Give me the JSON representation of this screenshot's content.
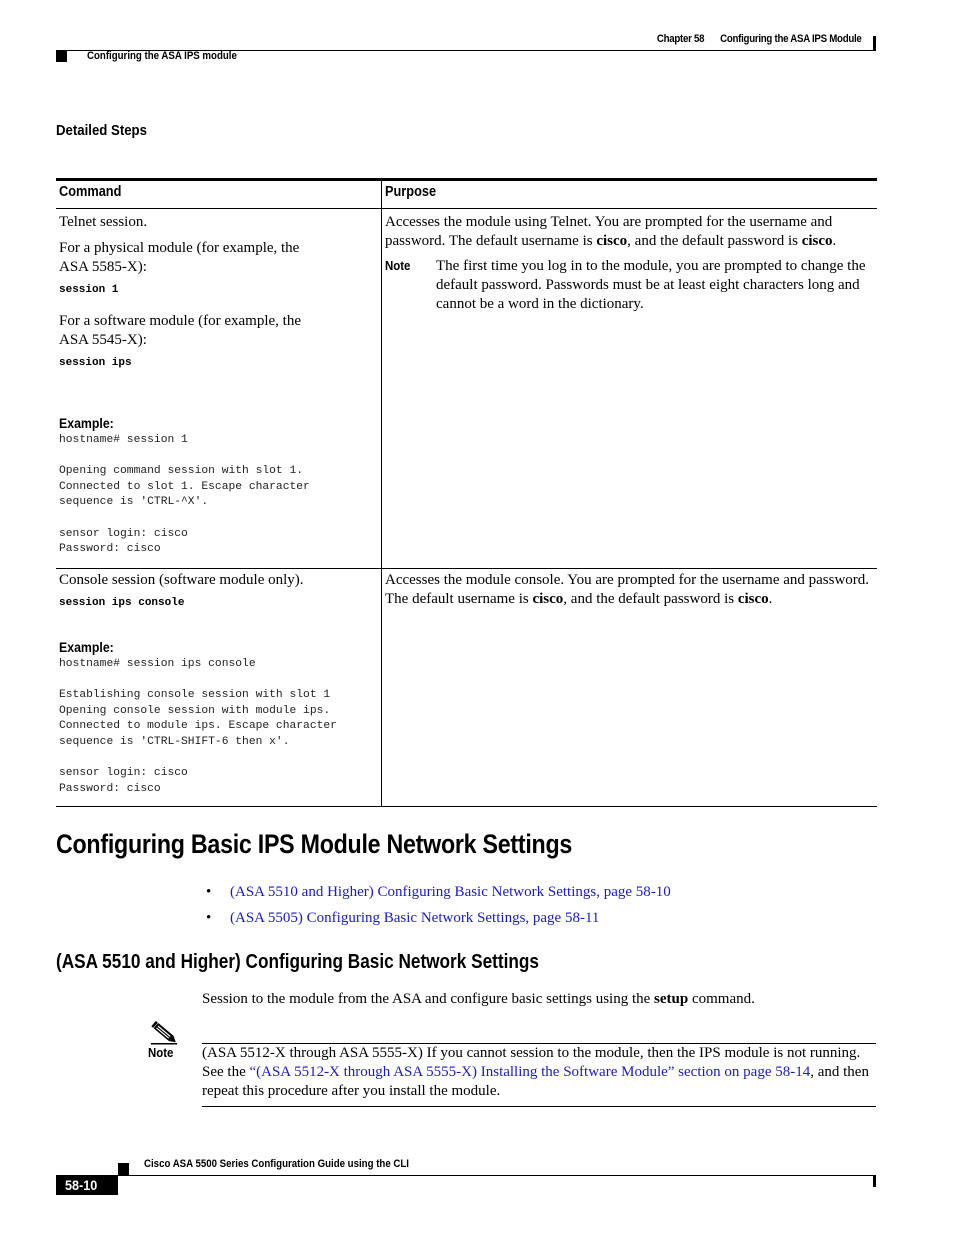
{
  "header": {
    "chapter": "Chapter 58",
    "chapter_title": "Configuring the ASA IPS Module",
    "section": "Configuring the ASA IPS module"
  },
  "detailed_steps_heading": "Detailed Steps",
  "table": {
    "columns": [
      "Command",
      "Purpose"
    ],
    "rows": [
      {
        "command": {
          "intro": "Telnet session.",
          "physical_label": "For a physical module (for example, the ASA 5585-X):",
          "physical_cmd": "session 1",
          "software_label": "For a software module (for example, the ASA 5545-X):",
          "software_cmd": "session ips",
          "example_label": "Example:",
          "example_code": "hostname# session 1\n\nOpening command session with slot 1.\nConnected to slot 1. Escape character\nsequence is 'CTRL-^X'.\n\nsensor login: cisco\nPassword: cisco"
        },
        "purpose": {
          "text_before": "Accesses the module using Telnet. You are prompted for the username and password. The default username is ",
          "bold1": "cisco",
          "text_middle": ", and the default password is ",
          "bold2": "cisco",
          "text_after": ".",
          "note_label": "Note",
          "note_text": "The first time you log in to the module, you are prompted to change the default password. Passwords must be at least eight characters long and cannot be a word in the dictionary."
        }
      },
      {
        "command": {
          "intro": "Console session (software module only).",
          "cmd": "session ips console",
          "example_label": "Example:",
          "example_code": "hostname# session ips console\n\nEstablishing console session with slot 1\nOpening console session with module ips.\nConnected to module ips. Escape character\nsequence is 'CTRL-SHIFT-6 then x'.\n\nsensor login: cisco\nPassword: cisco"
        },
        "purpose": {
          "text_before": "Accesses the module console. You are prompted for the username and password. The default username is ",
          "bold1": "cisco",
          "text_middle": ", and the default password is ",
          "bold2": "cisco",
          "text_after": "."
        }
      }
    ]
  },
  "section_heading": "Configuring Basic IPS Module Network Settings",
  "bullet_links": [
    "(ASA 5510 and Higher) Configuring Basic Network Settings, page 58-10",
    "(ASA 5505) Configuring Basic Network Settings, page 58-11"
  ],
  "subsection_heading": "(ASA 5510 and Higher) Configuring Basic Network Settings",
  "body_paragraph": {
    "before": "Session to the module from the ASA and configure basic settings using the ",
    "bold": "setup",
    "after": " command."
  },
  "note": {
    "icon": "pencil-note-icon",
    "label": "Note",
    "text_before": "(ASA 5512-X through ASA 5555-X) If you cannot session to the module, then the IPS module is not running. See the ",
    "link": "“(ASA 5512-X through ASA 5555-X) Installing the Software Module” section on page 58-14",
    "text_after": ", and then repeat this procedure after you install the module."
  },
  "footer": {
    "book_title": "Cisco ASA 5500 Series Configuration Guide using the CLI",
    "page_number": "58-10"
  },
  "colors": {
    "link": "#1a1acc",
    "text": "#000000"
  }
}
